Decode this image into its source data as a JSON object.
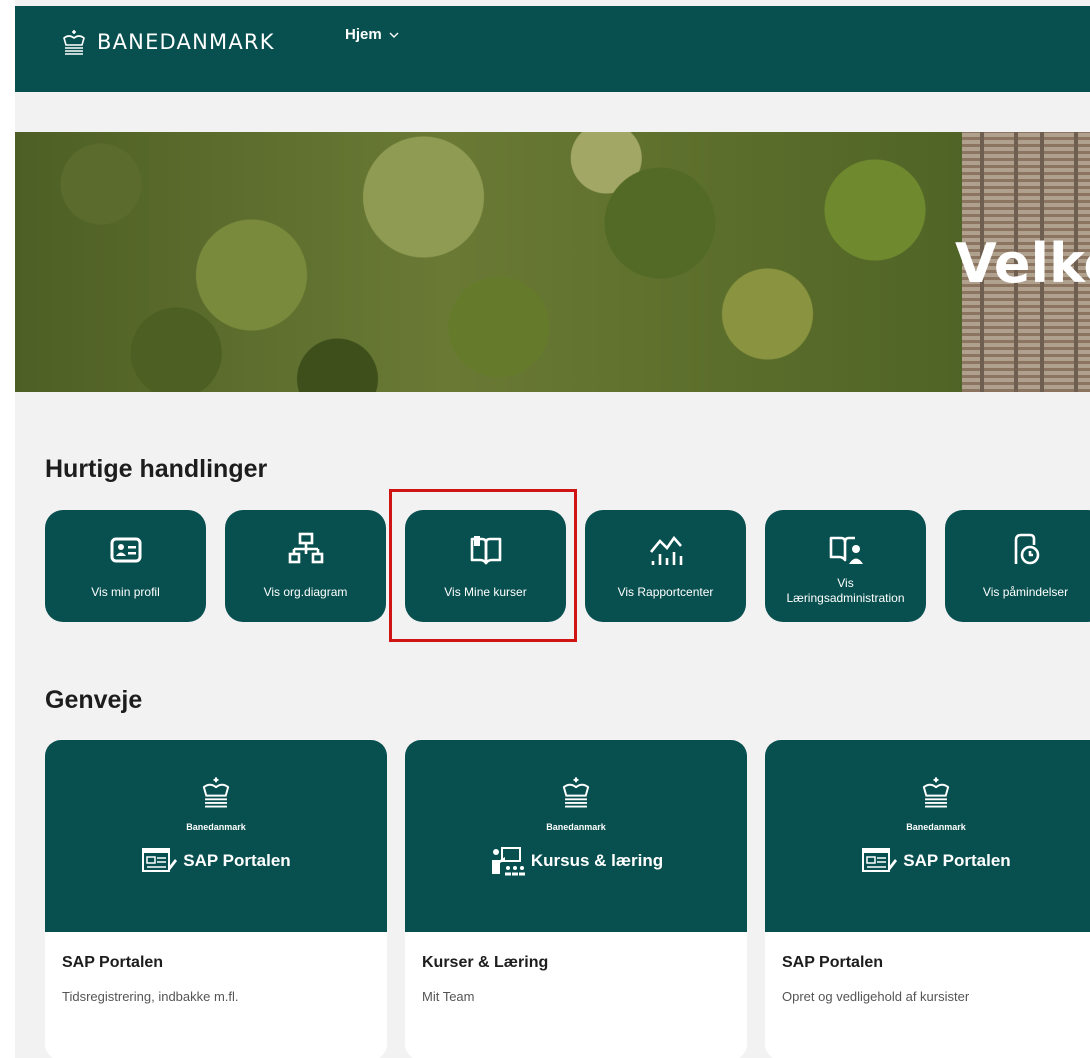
{
  "header": {
    "brand": "BANEDANMARK",
    "nav_label": "Hjem"
  },
  "hero": {
    "title": "Velko"
  },
  "quick_actions": {
    "title": "Hurtige handlinger",
    "items": [
      {
        "label": "Vis min profil",
        "icon": "id-card-icon"
      },
      {
        "label": "Vis org.diagram",
        "icon": "org-chart-icon"
      },
      {
        "label": "Vis Mine kurser",
        "icon": "open-book-icon",
        "highlighted": true
      },
      {
        "label": "Vis Rapportcenter",
        "icon": "line-chart-icon"
      },
      {
        "label": "Vis Læringsadministration",
        "label_line1": "Vis",
        "label_line2": "Læringsadministration",
        "icon": "book-user-icon"
      },
      {
        "label": "Vis påmindelser",
        "icon": "reminder-icon"
      }
    ]
  },
  "shortcuts": {
    "title": "Genveje",
    "items": [
      {
        "brand": "Banedanmark",
        "product": "SAP Portalen",
        "title": "SAP Portalen",
        "subtitle": "Tidsregistrering, indbakke m.fl."
      },
      {
        "brand": "Banedanmark",
        "product": "Kursus & læring",
        "title": "Kurser & Læring",
        "subtitle": "Mit Team"
      },
      {
        "brand": "Banedanmark",
        "product": "SAP Portalen",
        "title": "SAP Portalen",
        "subtitle": "Opret og vedligehold af kursister"
      }
    ]
  },
  "colors": {
    "primary": "#08504f",
    "highlight": "#d01313",
    "background": "#f2f2f2"
  }
}
